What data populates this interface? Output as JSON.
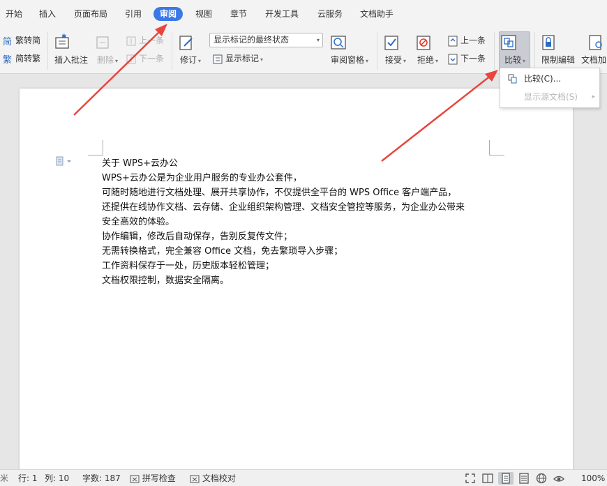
{
  "menu": {
    "tabs": [
      "开始",
      "插入",
      "页面布局",
      "引用",
      "审阅",
      "视图",
      "章节",
      "开发工具",
      "云服务",
      "文档助手"
    ],
    "active_tab": "审阅"
  },
  "ribbon": {
    "trad_to_simp": "繁转简",
    "simp_to_trad": "简转繁",
    "insert_comment": "插入批注",
    "delete": "删除",
    "prev_comment": "上一条",
    "next_comment": "下一条",
    "revise": "修订",
    "markup_combo_value": "显示标记的最终状态",
    "show_markup": "显示标记",
    "review_pane": "审阅窗格",
    "accept": "接受",
    "reject": "拒绝",
    "prev_change": "上一条",
    "next_change": "下一条",
    "compare": "比较",
    "restrict_edit": "限制编辑",
    "doc_encrypt": "文档加"
  },
  "compare_menu": {
    "compare_item": "比较(C)...",
    "show_source": "显示源文档(S)"
  },
  "document": {
    "lines": [
      "关于 WPS+云办公",
      "WPS+云办公是为企业用户服务的专业办公套件，",
      "可随时随地进行文档处理、展开共享协作，不仅提供全平台的 WPS Office 客户端产品，",
      "还提供在线协作文档、云存储、企业组织架构管理、文档安全管控等服务，为企业办公带来",
      "安全高效的体验。",
      "协作编辑，修改后自动保存，告别反复传文件；",
      "无需转换格式，完全兼容 Office 文档，免去繁琐导入步骤；",
      "工作资料保存于一处，历史版本轻松管理；",
      "文档权限控制，数据安全隔离。"
    ]
  },
  "status": {
    "row": "行: 1",
    "col": "列: 10",
    "words": "字数: 187",
    "spell_check": "拼写检查",
    "doc_proof": "文档校对",
    "zoom": "100%",
    "left_edge": "米"
  },
  "colors": {
    "accent": "#3b78e7",
    "annotation_arrow": "#e8453c"
  }
}
